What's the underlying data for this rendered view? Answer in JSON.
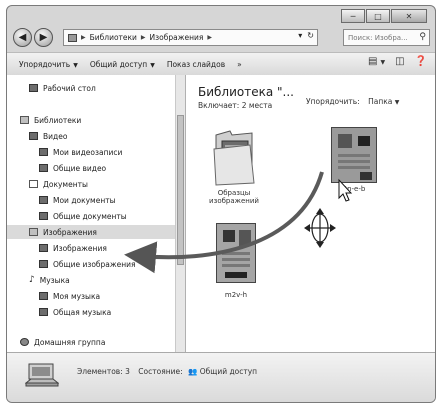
{
  "caption_buttons": {
    "minimize": "─",
    "maximize": "□",
    "close": "✕"
  },
  "address_bar": {
    "segments": [
      "Библиотеки",
      "Изображения"
    ],
    "refresh": "↻",
    "dropdown": "▾"
  },
  "search": {
    "placeholder": "Поиск: Изобра..."
  },
  "toolbar": {
    "organize": "Упорядочить",
    "share": "Общий доступ",
    "slideshow": "Показ слайдов",
    "more": "»"
  },
  "nav": {
    "items": [
      {
        "label": "Рабочий стол",
        "icon": "folder-icon"
      },
      {
        "label": "Библиотеки",
        "icon": "library-icon"
      },
      {
        "label": "Видео",
        "icon": "video-library-icon"
      },
      {
        "label": "Мои видеозаписи",
        "icon": "folder-icon"
      },
      {
        "label": "Общие видео",
        "icon": "folder-icon"
      },
      {
        "label": "Документы",
        "icon": "documents-library-icon"
      },
      {
        "label": "Мои документы",
        "icon": "folder-icon"
      },
      {
        "label": "Общие документы",
        "icon": "folder-icon"
      },
      {
        "label": "Изображения",
        "icon": "pictures-library-icon"
      },
      {
        "label": "Изображения",
        "icon": "folder-icon"
      },
      {
        "label": "Общие изображения",
        "icon": "folder-icon"
      },
      {
        "label": "Музыка",
        "icon": "music-library-icon"
      },
      {
        "label": "Моя музыка",
        "icon": "folder-icon"
      },
      {
        "label": "Общая музыка",
        "icon": "folder-icon"
      },
      {
        "label": "Домашняя группа",
        "icon": "homegroup-icon"
      }
    ]
  },
  "content": {
    "title": "Библиотека \"...",
    "includes": "Включает: 2 места",
    "arrange_label": "Упорядочить:",
    "arrange_value": "Папка",
    "files": [
      {
        "label": "Образцы изображений",
        "type": "folder"
      },
      {
        "label": "2n-e-b",
        "type": "image"
      },
      {
        "label": "m2v-h",
        "type": "image"
      }
    ]
  },
  "status": {
    "elements": "Элементов: 3",
    "state_label": "Состояние:",
    "state_value": "Общий доступ"
  }
}
